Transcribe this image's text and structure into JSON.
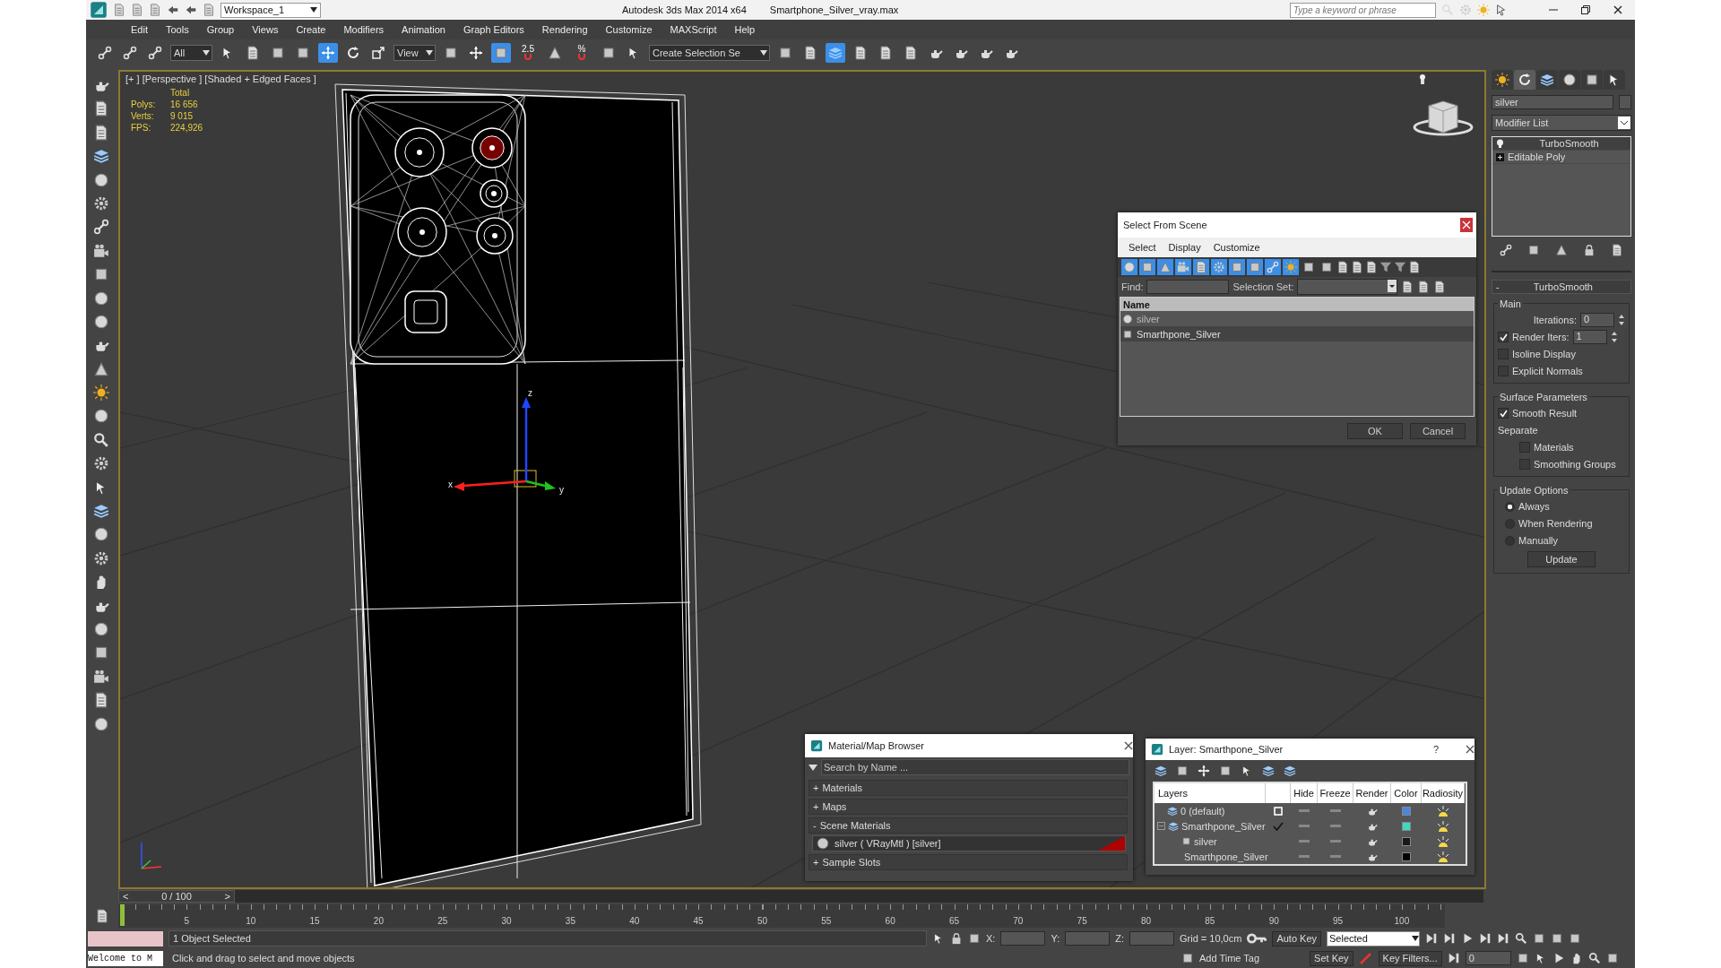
{
  "title_bar": {
    "workspace": "Workspace_1",
    "app": "Autodesk 3ds Max  2014 x64",
    "file": "Smartphone_Silver_vray.max",
    "search": {
      "placeholder": "Type a keyword or phrase"
    }
  },
  "menu": [
    "Edit",
    "Tools",
    "Group",
    "Views",
    "Create",
    "Modifiers",
    "Animation",
    "Graph Editors",
    "Rendering",
    "Customize",
    "MAXScript",
    "Help"
  ],
  "toolbar": [
    {
      "kind": "tool",
      "active": false
    },
    {
      "kind": "tool",
      "active": false
    },
    {
      "kind": "tool",
      "active": false
    },
    {
      "kind": "dropdown",
      "value": "All"
    },
    {
      "kind": "tool",
      "active": false
    },
    {
      "kind": "tool",
      "active": false
    },
    {
      "kind": "tool",
      "active": false
    },
    {
      "kind": "tool",
      "active": false
    },
    {
      "kind": "tool",
      "active": true
    },
    {
      "kind": "tool",
      "active": false
    },
    {
      "kind": "tool",
      "active": false
    },
    {
      "kind": "dropdown",
      "value": "View"
    },
    {
      "kind": "tool",
      "active": false
    },
    {
      "kind": "tool",
      "active": false
    },
    {
      "kind": "tool",
      "active": true
    },
    {
      "kind": "snap",
      "label": "2.5"
    },
    {
      "kind": "tool",
      "active": false
    },
    {
      "kind": "snap",
      "label": "%"
    },
    {
      "kind": "tool",
      "active": false
    },
    {
      "kind": "tool",
      "active": false
    },
    {
      "kind": "dropdown",
      "value": "Create Selection Se"
    },
    {
      "kind": "tool",
      "active": false
    },
    {
      "kind": "tool",
      "active": false
    },
    {
      "kind": "tool",
      "active": true
    },
    {
      "kind": "tool",
      "active": false
    },
    {
      "kind": "tool",
      "active": false
    },
    {
      "kind": "tool",
      "active": false
    },
    {
      "kind": "tool",
      "active": false
    },
    {
      "kind": "tool",
      "active": false
    },
    {
      "kind": "tool",
      "active": false
    },
    {
      "kind": "tool",
      "active": false
    }
  ],
  "viewport": {
    "label": "[+ ] [Perspective ] [Shaded + Edged Faces ]",
    "stats_header": "Total",
    "stats": [
      {
        "label": "Polys:",
        "value": "16 656"
      },
      {
        "label": "Verts:",
        "value": "9 015"
      },
      {
        "label": "FPS:",
        "value": "224,926"
      }
    ],
    "axes": [
      "x",
      "y",
      "z"
    ]
  },
  "select_dialog": {
    "title": "Select From Scene",
    "menu": [
      "Select",
      "Display",
      "Customize"
    ],
    "filters": [
      {
        "on": true
      },
      {
        "on": true
      },
      {
        "on": true
      },
      {
        "on": true
      },
      {
        "on": true
      },
      {
        "on": true
      },
      {
        "on": true
      },
      {
        "on": true
      },
      {
        "on": true
      },
      {
        "on": true
      },
      {
        "on": false
      },
      {
        "on": false
      }
    ],
    "find_label": "Find:",
    "selection_set_label": "Selection Set:",
    "column": "Name",
    "rows": [
      {
        "name": "silver",
        "kind": "material",
        "selected": false
      },
      {
        "name": "Smarthpone_Silver",
        "kind": "object",
        "selected": true
      }
    ],
    "buttons": [
      "OK",
      "Cancel"
    ]
  },
  "command_panel": {
    "tabs": [
      {
        "selected": false
      },
      {
        "selected": true
      },
      {
        "selected": false
      },
      {
        "selected": false
      },
      {
        "selected": false
      },
      {
        "selected": false
      }
    ],
    "name": "silver",
    "modifier_list": "Modifier List",
    "stack": [
      {
        "name": "TurboSmooth",
        "kind": "modifier",
        "selected": true
      },
      {
        "name": "Editable Poly",
        "kind": "base",
        "selected": false
      }
    ],
    "rollout": {
      "sign": "-",
      "title": "TurboSmooth",
      "groups": [
        {
          "title": "Main",
          "controls": [
            {
              "kind": "spinner",
              "label": "Iterations:",
              "value": "0"
            },
            {
              "kind": "check_spinner",
              "label": "Render Iters:",
              "checked": true,
              "value": "1"
            },
            {
              "kind": "checkbox",
              "label": "Isoline Display",
              "checked": false
            },
            {
              "kind": "checkbox",
              "label": "Explicit Normals",
              "checked": false
            }
          ]
        },
        {
          "title": "Surface Parameters",
          "controls": [
            {
              "kind": "checkbox",
              "label": "Smooth Result",
              "checked": true
            },
            {
              "kind": "caption",
              "label": "Separate"
            },
            {
              "kind": "subcheckbox",
              "label": "Materials",
              "checked": false
            },
            {
              "kind": "subcheckbox",
              "label": "Smoothing Groups",
              "checked": false
            }
          ]
        },
        {
          "title": "Update Options",
          "controls": [
            {
              "kind": "radio",
              "label": "Always",
              "selected": true
            },
            {
              "kind": "radio",
              "label": "When Rendering",
              "selected": false
            },
            {
              "kind": "radio",
              "label": "Manually",
              "selected": false
            },
            {
              "kind": "button",
              "label": "Update"
            }
          ]
        }
      ]
    }
  },
  "material_browser": {
    "title": "Material/Map Browser",
    "search": {
      "placeholder": "Search by Name ..."
    },
    "sections": [
      {
        "sign": "+",
        "label": "Materials"
      },
      {
        "sign": "+",
        "label": "Maps"
      },
      {
        "sign": "-",
        "label": "Scene Materials",
        "items": [
          {
            "name": "silver ( VRayMtl ) [silver]",
            "color": "#b00000"
          }
        ]
      },
      {
        "sign": "+",
        "label": "Sample Slots"
      }
    ]
  },
  "layer_dialog": {
    "title": "Layer: Smarthpone_Silver",
    "help": "?",
    "columns": [
      "Layers",
      "Hide",
      "Freeze",
      "Render",
      "Color",
      "Radiosity"
    ],
    "rows": [
      {
        "name": "0 (default)",
        "current": false,
        "expanded": false,
        "color": "#4a86e0"
      },
      {
        "name": "Smarthpone_Silver",
        "current": true,
        "expanded": true,
        "color": "#40d8c0",
        "children": [
          {
            "name": "silver",
            "color": "#1a1a1a"
          },
          {
            "name": "Smarthpone_Silver",
            "color": "#000000"
          }
        ]
      }
    ]
  },
  "timeline": {
    "level": 0,
    "prev": "<",
    "position": "0 / 100",
    "next": ">",
    "ticks": [
      "5",
      "10",
      "15",
      "20",
      "25",
      "30",
      "35",
      "40",
      "45",
      "50",
      "55",
      "60",
      "65",
      "70",
      "75",
      "80",
      "85",
      "90",
      "95",
      "100"
    ]
  },
  "status": {
    "listener": "Welcome to M",
    "selection": "1 Object Selected",
    "prompt": "Click and drag to select and move objects",
    "coords": [
      "X:",
      "Y:",
      "Z:"
    ],
    "grid": "Grid = 10,0cm",
    "time_tag": "Add Time Tag",
    "auto_key": "Auto Key",
    "key_mode": "Selected",
    "set_key": "Set Key",
    "key_filters": "Key Filters...",
    "frame": "0"
  }
}
